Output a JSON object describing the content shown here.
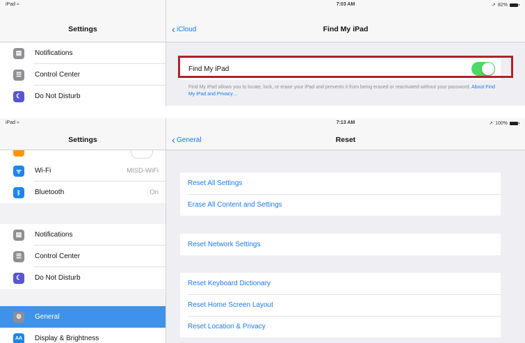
{
  "colors": {
    "accent": "#1479f6",
    "toggle_on": "#4cd964",
    "selected": "#3f92e9",
    "highlight_box": "#b3202d"
  },
  "shot1": {
    "status": {
      "device": "iPad",
      "time": "7:03 AM",
      "battery": "82%"
    },
    "sidebar": {
      "title": "Settings",
      "items": [
        {
          "label": "Notifications",
          "icon": "notifications-icon",
          "color": "#8e8e93"
        },
        {
          "label": "Control Center",
          "icon": "control-center-icon",
          "color": "#8e8e93"
        },
        {
          "label": "Do Not Disturb",
          "icon": "moon-icon",
          "color": "#5856d6"
        }
      ]
    },
    "nav": {
      "back": "iCloud",
      "title": "Find My iPad"
    },
    "find_my": {
      "label": "Find My iPad",
      "toggle_on": true,
      "footnote": "Find My iPad allows you to locate, lock, or erase your iPad and prevents it from being erased or reactivated without your password.",
      "footnote_link": "About Find My iPad and Privacy…"
    }
  },
  "shot2": {
    "status": {
      "device": "iPad",
      "time": "7:13 AM",
      "battery": "100%"
    },
    "sidebar": {
      "title": "Settings",
      "network_items": [
        {
          "label": "Wi-Fi",
          "value": "MISD-WiFi",
          "icon": "wifi-icon",
          "color": "#1b86f0"
        },
        {
          "label": "Bluetooth",
          "value": "On",
          "icon": "bluetooth-icon",
          "color": "#1b86f0"
        }
      ],
      "items": [
        {
          "label": "Notifications",
          "icon": "notifications-icon",
          "color": "#8e8e93"
        },
        {
          "label": "Control Center",
          "icon": "control-center-icon",
          "color": "#8e8e93"
        },
        {
          "label": "Do Not Disturb",
          "icon": "moon-icon",
          "color": "#5856d6"
        }
      ],
      "general_items": [
        {
          "label": "General",
          "icon": "gear-icon",
          "color": "#8e8e93",
          "selected": true
        },
        {
          "label": "Display & Brightness",
          "icon": "display-icon",
          "color": "#1b86f0"
        }
      ]
    },
    "nav": {
      "back": "General",
      "title": "Reset"
    },
    "reset_groups": [
      [
        "Reset All Settings",
        "Erase All Content and Settings"
      ],
      [
        "Reset Network Settings"
      ],
      [
        "Reset Keyboard Dictionary",
        "Reset Home Screen Layout",
        "Reset Location & Privacy"
      ]
    ]
  }
}
